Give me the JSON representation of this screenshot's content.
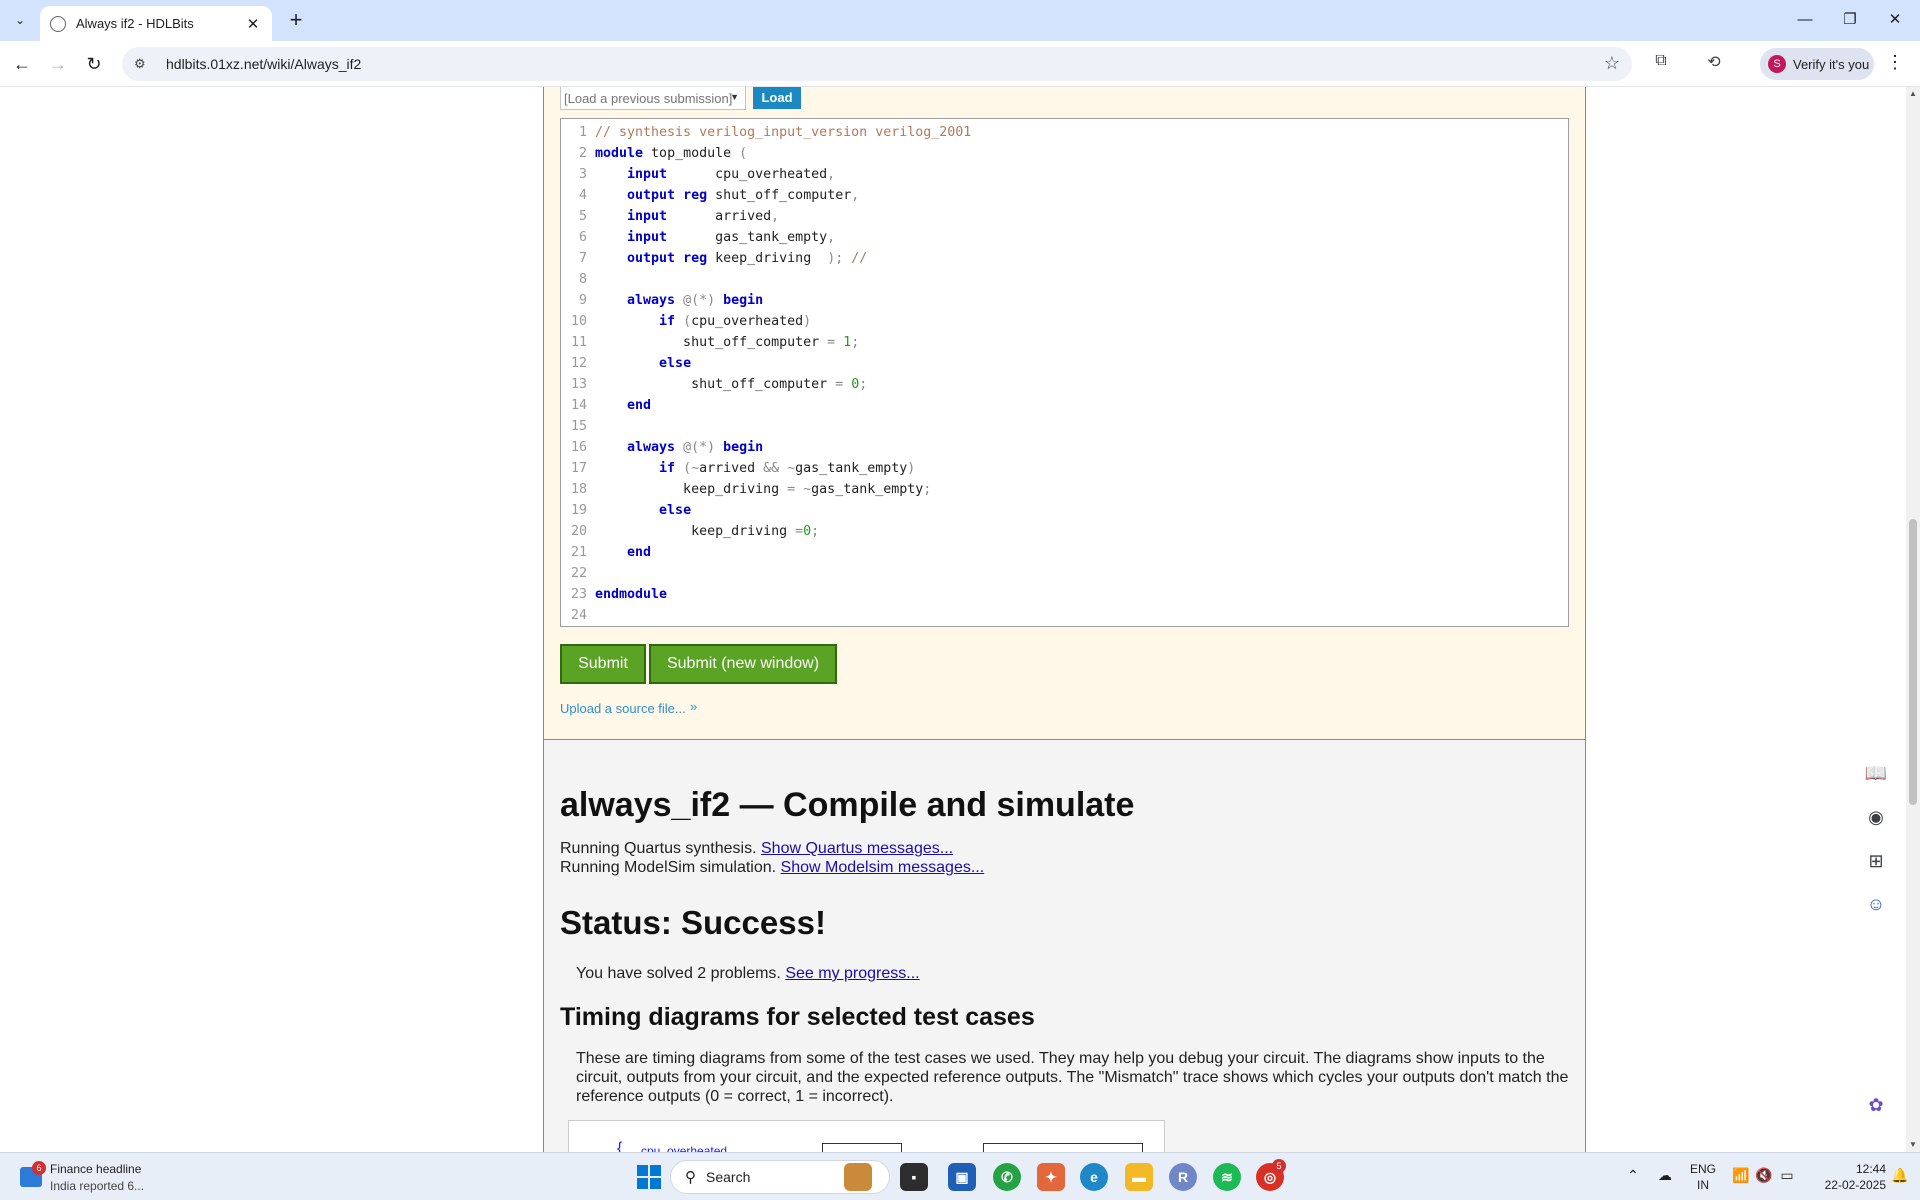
{
  "browser": {
    "tab_title": "Always if2 - HDLBits",
    "url": "hdlbits.01xz.net/wiki/Always_if2",
    "profile_initial": "S",
    "profile_label": "Verify it's you",
    "new_tab_symbol": "+"
  },
  "submission": {
    "load_placeholder": "[Load a previous submission]",
    "load_button": "Load",
    "submit_label": "Submit",
    "submit_new_window_label": "Submit (new window)",
    "upload_link": "Upload a source file...",
    "code_lines": [
      {
        "n": "1",
        "html": "<span class='cm'>// synthesis verilog_input_version verilog_2001</span>"
      },
      {
        "n": "2",
        "html": "<span class='kw'>module</span> top_module <span class='op'>(</span>"
      },
      {
        "n": "3",
        "html": "    <span class='kw'>input</span>      cpu_overheated<span class='op'>,</span>"
      },
      {
        "n": "4",
        "html": "    <span class='kw'>output</span> <span class='kw'>reg</span> shut_off_computer<span class='op'>,</span>"
      },
      {
        "n": "5",
        "html": "    <span class='kw'>input</span>      arrived<span class='op'>,</span>"
      },
      {
        "n": "6",
        "html": "    <span class='kw'>input</span>      gas_tank_empty<span class='op'>,</span>"
      },
      {
        "n": "7",
        "html": "    <span class='kw'>output</span> <span class='kw'>reg</span> keep_driving  <span class='op'>);</span> <span class='cm'>//</span>"
      },
      {
        "n": "8",
        "html": ""
      },
      {
        "n": "9",
        "html": "    <span class='kw'>always</span> <span class='op'>@(*)</span> <span class='kw'>begin</span>"
      },
      {
        "n": "10",
        "html": "        <span class='kw'>if</span> <span class='op'>(</span>cpu_overheated<span class='op'>)</span>"
      },
      {
        "n": "11",
        "html": "           shut_off_computer <span class='op'>=</span> <span class='num'>1</span><span class='op'>;</span>"
      },
      {
        "n": "12",
        "html": "        <span class='kw'>else</span>"
      },
      {
        "n": "13",
        "html": "            shut_off_computer <span class='op'>=</span> <span class='num'>0</span><span class='op'>;</span>"
      },
      {
        "n": "14",
        "html": "    <span class='kw'>end</span>"
      },
      {
        "n": "15",
        "html": ""
      },
      {
        "n": "16",
        "html": "    <span class='kw'>always</span> <span class='op'>@(*)</span> <span class='kw'>begin</span>"
      },
      {
        "n": "17",
        "html": "        <span class='kw'>if</span> <span class='op'>(~</span>arrived <span class='op'>&amp;&amp; ~</span>gas_tank_empty<span class='op'>)</span>"
      },
      {
        "n": "18",
        "html": "           keep_driving <span class='op'>= ~</span>gas_tank_empty<span class='op'>;</span>"
      },
      {
        "n": "19",
        "html": "        <span class='kw'>else</span>"
      },
      {
        "n": "20",
        "html": "            keep_driving <span class='op'>=</span><span class='num'>0</span><span class='op'>;</span>"
      },
      {
        "n": "21",
        "html": "    <span class='kw'>end</span>"
      },
      {
        "n": "22",
        "html": ""
      },
      {
        "n": "23",
        "html": "<span class='kw'>endmodule</span>"
      },
      {
        "n": "24",
        "html": ""
      }
    ]
  },
  "result": {
    "heading": "always_if2 — Compile and simulate",
    "quartus_text": "Running Quartus synthesis. ",
    "quartus_link": "Show Quartus messages...",
    "modelsim_text": "Running ModelSim simulation. ",
    "modelsim_link": "Show Modelsim messages...",
    "status_heading": "Status: Success!",
    "solved_text": "You have solved 2 problems. ",
    "progress_link": "See my progress...",
    "timing_heading": "Timing diagrams for selected test cases",
    "timing_paragraph": "These are timing diagrams from some of the test cases we used. They may help you debug your circuit. The diagrams show inputs to the circuit, outputs from your circuit, and the expected reference outputs. The \"Mismatch\" trace shows which cycles your outputs don't match the reference outputs (0 = correct, 1 = incorrect).",
    "timing_signal": "cpu_overheated"
  },
  "taskbar": {
    "news_badge": "6",
    "news_title": "Finance headline",
    "news_sub": "India reported 6...",
    "search_label": "Search",
    "lang_line1": "ENG",
    "lang_line2": "IN",
    "time": "12:44",
    "date": "22-02-2025",
    "chrome_badge": "5"
  }
}
